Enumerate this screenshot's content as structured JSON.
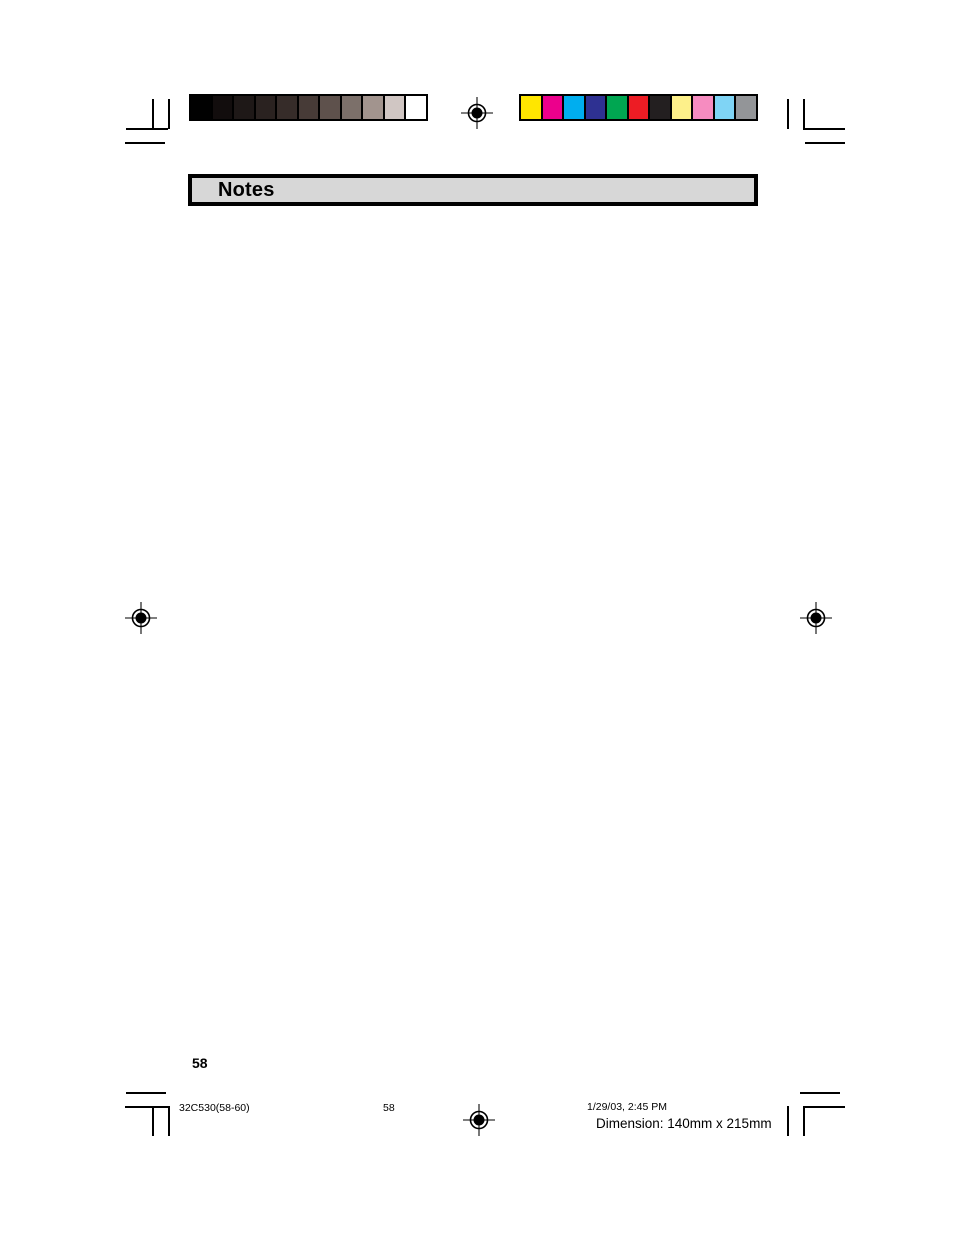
{
  "page": {
    "document_title": "Notes",
    "page_number": "58",
    "background_color": "#ffffff"
  },
  "header": {
    "banner_title": "Notes",
    "banner_fill_color": "#d7d7d7",
    "banner_border_color": "#000000"
  },
  "content": {
    "body_text": ""
  },
  "calibration": {
    "grayscale_label": "grayscale-step-wedge",
    "grayscale_swatches": [
      "#010101",
      "#120d0d",
      "#1e1817",
      "#2a2220",
      "#362c29",
      "#473b37",
      "#5e514c",
      "#7c706a",
      "#a2948e",
      "#d0c6c3",
      "#ffffff"
    ],
    "color_label": "color-control-bar",
    "color_swatches": [
      "#ffe600",
      "#ec008c",
      "#00aeef",
      "#2e3192",
      "#00a651",
      "#ed1c24",
      "#231f20",
      "#fdf08a",
      "#f68cc0",
      "#7fd4f5",
      "#939598"
    ]
  },
  "footer": {
    "file_slug": "32C530(58-60)",
    "page_slug": "58",
    "timestamp": "1/29/03, 2:45 PM",
    "dimension": "Dimension: 140mm x 215mm"
  },
  "marks": {
    "registration_mark_name": "registration-target",
    "crop_mark_name": "crop-mark"
  }
}
